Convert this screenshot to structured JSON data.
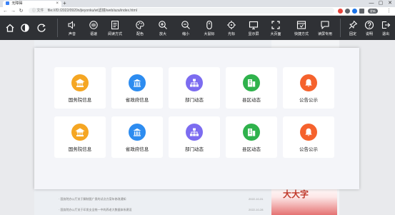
{
  "browser": {
    "tab_title": "无障碍",
    "tab_close": "×",
    "new_tab": "+",
    "secure_label": "ⓘ 文件",
    "url": "file:///D:/2022/0920n/jieyonku/wt滤镜/web/aza/index.html",
    "win_min": "—",
    "win_max": "▢",
    "win_close": "✕",
    "profile_label": "更新"
  },
  "toolbar": {
    "home": "",
    "contrast": "",
    "refresh": "",
    "items": [
      {
        "label": "声音",
        "icon": "speaker-icon"
      },
      {
        "label": "语速",
        "icon": "speed-icon"
      },
      {
        "label": "阅读方式",
        "icon": "reading-mode-icon"
      },
      {
        "label": "配色",
        "icon": "palette-icon"
      },
      {
        "label": "放大",
        "icon": "zoom-in-icon"
      },
      {
        "label": "缩小",
        "icon": "zoom-out-icon"
      },
      {
        "label": "大鼠标",
        "icon": "mouse-icon"
      },
      {
        "label": "光标",
        "icon": "crosshair-icon"
      },
      {
        "label": "显示屏",
        "icon": "monitor-icon"
      },
      {
        "label": "大页面",
        "icon": "fullscreen-icon"
      },
      {
        "label": "快捷方式",
        "icon": "shortcut-icon"
      },
      {
        "label": "读屏专用",
        "icon": "screen-reader-icon"
      }
    ],
    "right": [
      {
        "label": "固定",
        "icon": "pin-icon"
      },
      {
        "label": "说明",
        "icon": "help-icon"
      },
      {
        "label": "退出",
        "icon": "exit-icon"
      }
    ]
  },
  "modal": {
    "rows": [
      [
        {
          "label": "国务院信息",
          "color": "#f5a623",
          "icon": "state-council-icon"
        },
        {
          "label": "省政府信息",
          "color": "#2d8cf0",
          "icon": "government-building-icon"
        },
        {
          "label": "部门动态",
          "color": "#7c6cf0",
          "icon": "department-org-icon"
        },
        {
          "label": "县区动态",
          "color": "#2fb24c",
          "icon": "district-building-icon"
        },
        {
          "label": "公告公示",
          "color": "#f5622d",
          "icon": "bell-icon"
        }
      ],
      [
        {
          "label": "国务院信息",
          "color": "#f5a623",
          "icon": "state-council-icon"
        },
        {
          "label": "省政府信息",
          "color": "#2d8cf0",
          "icon": "government-building-icon"
        },
        {
          "label": "部门动态",
          "color": "#7c6cf0",
          "icon": "department-org-icon"
        },
        {
          "label": "县区动态",
          "color": "#2fb24c",
          "icon": "district-building-icon"
        },
        {
          "label": "公告公示",
          "color": "#f5622d",
          "icon": "bell-icon"
        }
      ]
    ]
  },
  "background": {
    "news": [
      {
        "title": "国务院办公厅关于解制图广责的试点方案年修改通知",
        "date": "2022-10-31"
      },
      {
        "title": "国务院办公厅关于印发支全统一中的养老大数据体系建设",
        "date": "2022-10-28"
      }
    ],
    "banner_text": "大大字"
  },
  "colors": {
    "toolbar_bg": "#2f3135",
    "modal_bg": "#f4f5f9",
    "card_bg": "#ffffff"
  }
}
